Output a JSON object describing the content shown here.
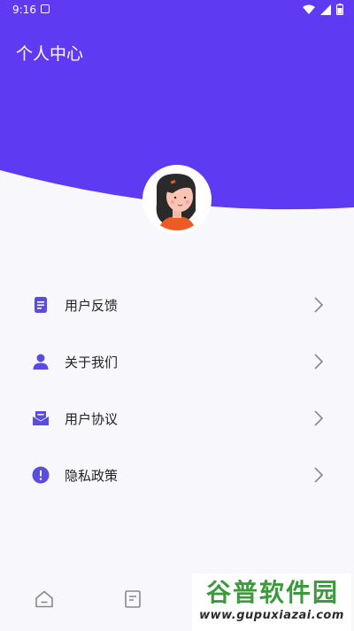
{
  "status_bar": {
    "time": "9:16"
  },
  "header": {
    "title": "个人中心",
    "color": "#5e3af3"
  },
  "menu": [
    {
      "label": "用户反馈",
      "icon": "document-icon"
    },
    {
      "label": "关于我们",
      "icon": "person-icon"
    },
    {
      "label": "用户协议",
      "icon": "mail-icon"
    },
    {
      "label": "隐私政策",
      "icon": "alert-icon"
    }
  ],
  "bottom_nav": [
    {
      "icon": "home-icon"
    },
    {
      "icon": "note-icon"
    }
  ],
  "watermark": {
    "logo": "谷普软件园",
    "url": "www.gupuxiazai.com"
  },
  "colors": {
    "accent": "#5e3af3",
    "icon_purple": "#5b4ce0",
    "chevron": "#888888"
  }
}
